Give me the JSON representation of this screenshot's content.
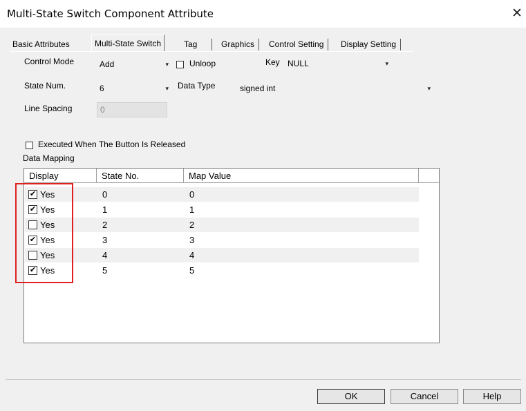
{
  "window": {
    "title": "Multi-State Switch Component Attribute",
    "close_glyph": "✕"
  },
  "tabs": [
    {
      "label": "Basic Attributes"
    },
    {
      "label": "Multi-State Switch"
    },
    {
      "label": "Tag"
    },
    {
      "label": "Graphics"
    },
    {
      "label": "Control Setting"
    },
    {
      "label": "Display Setting"
    }
  ],
  "form": {
    "control_mode_label": "Control Mode",
    "control_mode_value": "Add",
    "unloop_label": "Unloop",
    "unloop_checked": false,
    "key_label": "Key",
    "key_value": "NULL",
    "state_num_label": "State Num.",
    "state_num_value": "6",
    "data_type_label": "Data Type",
    "data_type_value": "signed int",
    "line_spacing_label": "Line Spacing",
    "line_spacing_value": "0",
    "executed_label": "Executed When The Button Is Released",
    "executed_checked": false,
    "data_mapping_label": "Data Mapping"
  },
  "table": {
    "columns": [
      "Display",
      "State No.",
      "Map Value"
    ],
    "rows": [
      {
        "checked": true,
        "display": "Yes",
        "state": "0",
        "map": "0"
      },
      {
        "checked": true,
        "display": "Yes",
        "state": "1",
        "map": "1"
      },
      {
        "checked": false,
        "display": "Yes",
        "state": "2",
        "map": "2"
      },
      {
        "checked": true,
        "display": "Yes",
        "state": "3",
        "map": "3"
      },
      {
        "checked": false,
        "display": "Yes",
        "state": "4",
        "map": "4"
      },
      {
        "checked": true,
        "display": "Yes",
        "state": "5",
        "map": "5"
      }
    ]
  },
  "buttons": {
    "ok": "OK",
    "cancel": "Cancel",
    "help": "Help"
  },
  "colors": {
    "highlight": "#e02020",
    "dialog_bg": "#f0f0f0"
  },
  "icons": {
    "dropdown": "▾",
    "check": "✔"
  }
}
